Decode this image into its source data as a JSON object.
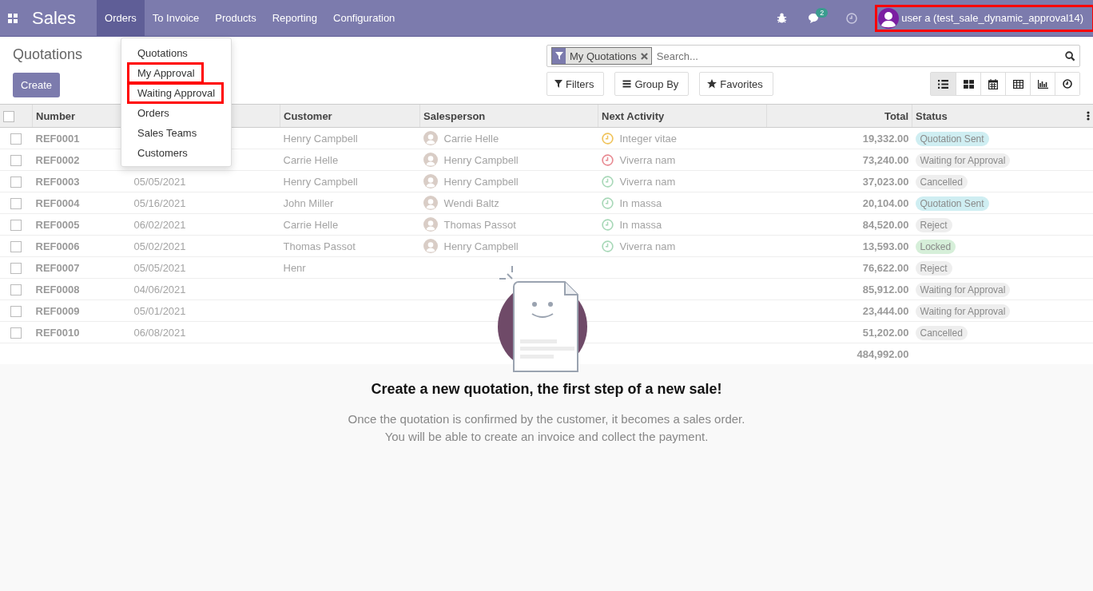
{
  "navbar": {
    "app_name": "Sales",
    "menus": [
      {
        "label": "Orders",
        "selected": true
      },
      {
        "label": "To Invoice",
        "selected": false
      },
      {
        "label": "Products",
        "selected": false
      },
      {
        "label": "Reporting",
        "selected": false
      },
      {
        "label": "Configuration",
        "selected": false
      }
    ],
    "message_count": "2",
    "user": {
      "name": "user a (test_sale_dynamic_approval14)",
      "highlighted": true
    }
  },
  "orders_menu": [
    {
      "label": "Quotations",
      "highlighted": false
    },
    {
      "label": "My Approval",
      "highlighted": true
    },
    {
      "label": "Waiting Approval",
      "highlighted": true
    },
    {
      "label": "Orders",
      "highlighted": false
    },
    {
      "label": "Sales Teams",
      "highlighted": false
    },
    {
      "label": "Customers",
      "highlighted": false
    }
  ],
  "breadcrumb": "Quotations",
  "create_button": "Create",
  "search": {
    "facet": "My Quotations",
    "placeholder": "Search..."
  },
  "search_buttons": [
    "Filters",
    "Group By",
    "Favorites"
  ],
  "views": [
    {
      "kind": "list",
      "selected": true
    },
    {
      "kind": "kanban",
      "selected": false
    },
    {
      "kind": "calendar",
      "selected": false
    },
    {
      "kind": "pivot",
      "selected": false
    },
    {
      "kind": "graph",
      "selected": false
    },
    {
      "kind": "activity",
      "selected": false
    }
  ],
  "table": {
    "select_all_checked": false,
    "columns": [
      "Number",
      "",
      "Customer",
      "Salesperson",
      "Next Activity",
      "Total",
      "Status"
    ],
    "rows": [
      {
        "checked": false,
        "number": "REF0001",
        "date": "",
        "customer": "Henry Campbell",
        "salesperson": "Carrie Helle",
        "activity": {
          "label": "Integer vitae",
          "color": "#f0c35a"
        },
        "total": "19,332.00",
        "status": {
          "label": "Quotation Sent",
          "color": "#cfeef2"
        }
      },
      {
        "checked": false,
        "number": "REF0002",
        "date": "",
        "customer": "Carrie Helle",
        "salesperson": "Henry Campbell",
        "activity": {
          "label": "Viverra nam",
          "color": "#e88a92"
        },
        "total": "73,240.00",
        "status": {
          "label": "Waiting for Approval",
          "color": "#eeeeee"
        }
      },
      {
        "checked": false,
        "number": "REF0003",
        "date": "05/05/2021",
        "customer": "Henry Campbell",
        "salesperson": "Henry Campbell",
        "activity": {
          "label": "Viverra nam",
          "color": "#a8d8b8"
        },
        "total": "37,023.00",
        "status": {
          "label": "Cancelled",
          "color": "#eeeeee"
        }
      },
      {
        "checked": false,
        "number": "REF0004",
        "date": "05/16/2021",
        "customer": "John Miller",
        "salesperson": "Wendi Baltz",
        "activity": {
          "label": "In massa",
          "color": "#a8d8b8"
        },
        "total": "20,104.00",
        "status": {
          "label": "Quotation Sent",
          "color": "#cfeef2"
        }
      },
      {
        "checked": false,
        "number": "REF0005",
        "date": "06/02/2021",
        "customer": "Carrie Helle",
        "salesperson": "Thomas Passot",
        "activity": {
          "label": "In massa",
          "color": "#a8d8b8"
        },
        "total": "84,520.00",
        "status": {
          "label": "Reject",
          "color": "#eeeeee"
        }
      },
      {
        "checked": false,
        "number": "REF0006",
        "date": "05/02/2021",
        "customer": "Thomas Passot",
        "salesperson": "Henry Campbell",
        "activity": {
          "label": "Viverra nam",
          "color": "#a8d8b8"
        },
        "total": "13,593.00",
        "status": {
          "label": "Locked",
          "color": "#d6efd9"
        }
      },
      {
        "checked": false,
        "number": "REF0007",
        "date": "05/05/2021",
        "customer": "Henr",
        "salesperson": "",
        "total": "76,622.00",
        "status": {
          "label": "Reject",
          "color": "#eeeeee"
        }
      },
      {
        "checked": false,
        "number": "REF0008",
        "date": "04/06/2021",
        "customer": "",
        "salesperson": "",
        "total": "85,912.00",
        "status": {
          "label": "Waiting for Approval",
          "color": "#eeeeee"
        }
      },
      {
        "checked": false,
        "number": "REF0009",
        "date": "05/01/2021",
        "customer": "",
        "salesperson": "",
        "total": "23,444.00",
        "status": {
          "label": "Waiting for Approval",
          "color": "#eeeeee"
        }
      },
      {
        "checked": false,
        "number": "REF0010",
        "date": "06/08/2021",
        "customer": "",
        "salesperson": "",
        "total": "51,202.00",
        "status": {
          "label": "Cancelled",
          "color": "#eeeeee"
        }
      }
    ],
    "grand_total": "484,992.00"
  },
  "help": {
    "title": "Create a new quotation, the first step of a new sale!",
    "lines": [
      "Once the quotation is confirmed by the customer, it becomes a sales order.",
      "You will be able to create an invoice and collect the payment."
    ]
  }
}
